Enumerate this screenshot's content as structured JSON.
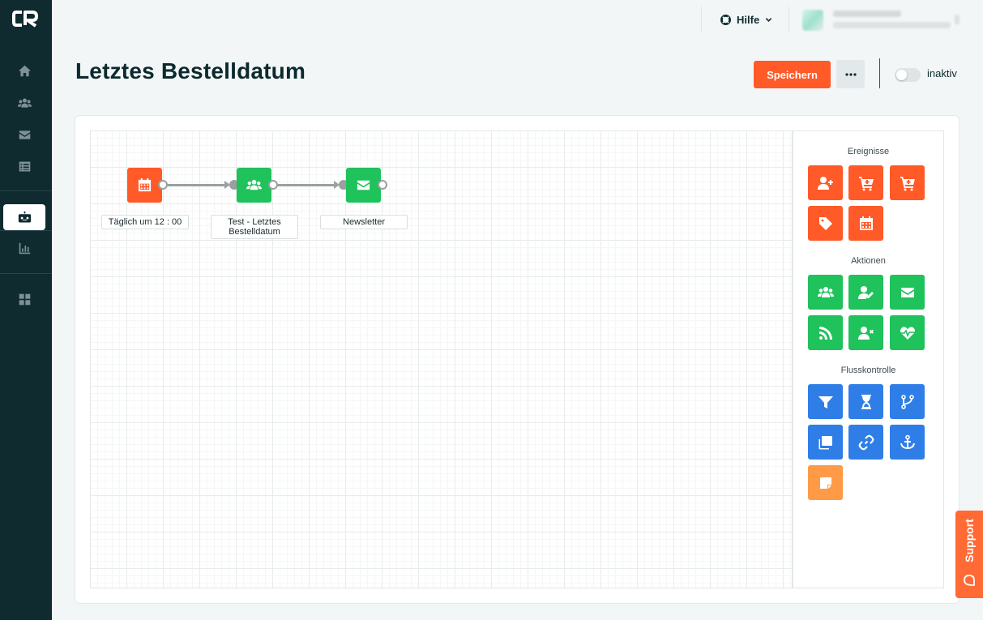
{
  "sidebar": {
    "items": [
      {
        "icon": "home-icon"
      },
      {
        "icon": "users-icon"
      },
      {
        "icon": "mail-icon"
      },
      {
        "icon": "list-icon"
      },
      {
        "icon": "robot-icon",
        "active": true
      },
      {
        "icon": "chart-icon"
      },
      {
        "icon": "dashboard-icon"
      }
    ]
  },
  "topbar": {
    "help_label": "Hilfe"
  },
  "header": {
    "title": "Letztes Bestelldatum",
    "save_label": "Speichern",
    "status_label": "inaktiv"
  },
  "flow": {
    "nodes": [
      {
        "label": "Täglich um 12 : 00",
        "icon": "calendar-icon",
        "color": "#ff5a28"
      },
      {
        "label": "Test - Letztes Bestelldatum",
        "icon": "users-icon",
        "color": "#1fc25b"
      },
      {
        "label": "Newsletter",
        "icon": "mail-icon",
        "color": "#1fc25b"
      }
    ]
  },
  "palette": {
    "events_title": "Ereignisse",
    "actions_title": "Aktionen",
    "flow_title": "Flusskontrolle"
  },
  "support_label": "Support",
  "colors": {
    "accent": "#ff5a28",
    "sidebar_bg": "#0f2b30",
    "action_green": "#1fc25b",
    "flow_blue": "#2f7ee8"
  }
}
